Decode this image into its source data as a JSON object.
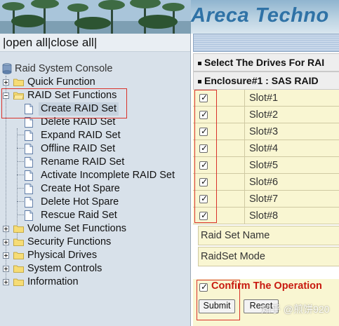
{
  "banner": {
    "brand": "Areca Techno"
  },
  "nav": {
    "open_all": "open all",
    "close_all": "close all",
    "separator": "|",
    "root": "Raid System Console",
    "items": [
      {
        "label": "Quick Function"
      },
      {
        "label": "RAID Set Functions"
      },
      {
        "label": "Create RAID Set"
      },
      {
        "label": "Delete RAID Set"
      },
      {
        "label": "Expand RAID Set"
      },
      {
        "label": "Offline RAID Set"
      },
      {
        "label": "Rename RAID Set"
      },
      {
        "label": "Activate Incomplete RAID Set"
      },
      {
        "label": "Create Hot Spare"
      },
      {
        "label": "Delete Hot Spare"
      },
      {
        "label": "Rescue Raid Set"
      },
      {
        "label": "Volume Set Functions"
      },
      {
        "label": "Security Functions"
      },
      {
        "label": "Physical Drives"
      },
      {
        "label": "System Controls"
      },
      {
        "label": "Information"
      }
    ]
  },
  "main": {
    "header_select": "Select The Drives For RAI",
    "header_enclosure": "Enclosure#1 : SAS RAID",
    "slots": [
      {
        "name": "Slot#1",
        "checked": true
      },
      {
        "name": "Slot#2",
        "checked": true
      },
      {
        "name": "Slot#3",
        "checked": true
      },
      {
        "name": "Slot#4",
        "checked": true
      },
      {
        "name": "Slot#5",
        "checked": true
      },
      {
        "name": "Slot#6",
        "checked": true
      },
      {
        "name": "Slot#7",
        "checked": true
      },
      {
        "name": "Slot#8",
        "checked": true
      }
    ],
    "raid_set_name_label": "Raid Set Name",
    "raid_set_mode_label": "RaidSet Mode",
    "confirm_label": "Confirm The Operation",
    "confirm_checked": true,
    "submit_label": "Submit",
    "reset_label": "Reset"
  },
  "watermark": "知乎 @煎饼920",
  "colors": {
    "brand_blue": "#2f72a6",
    "highlight_red": "#d9322a",
    "confirm_red": "#c8190f",
    "row_yellow": "#f9f6d2",
    "nav_bg": "#d8e1ea"
  },
  "icons": {
    "root": "console-disk-icon",
    "folder": "folder-icon",
    "document": "document-icon",
    "expander": "tree-expander-icon",
    "checkmark": "checkmark-icon"
  }
}
